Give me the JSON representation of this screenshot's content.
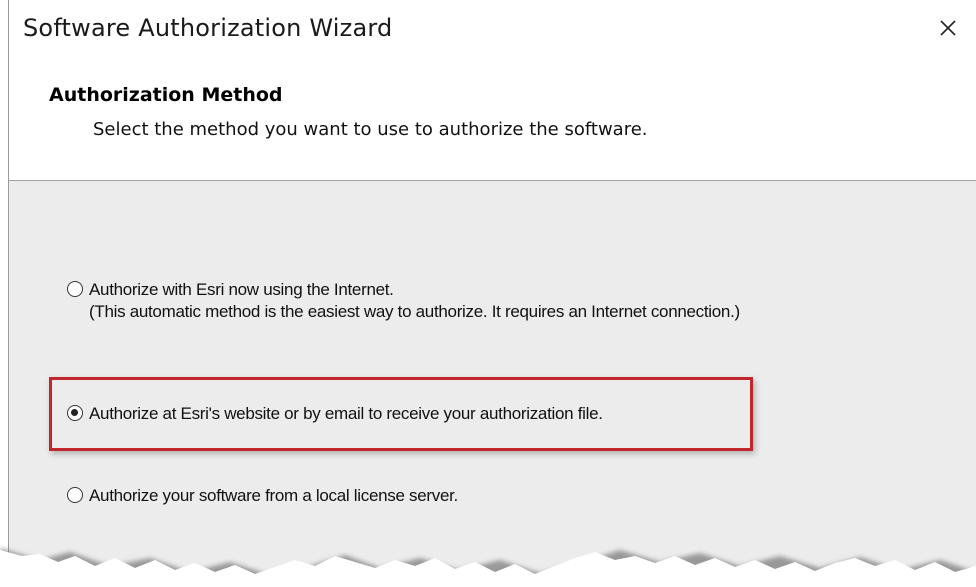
{
  "window": {
    "title": "Software Authorization Wizard"
  },
  "header": {
    "title": "Authorization Method",
    "subtitle": "Select the method you want to use to authorize the software."
  },
  "options": [
    {
      "label": "Authorize with Esri now using the Internet.",
      "detail": "(This automatic method is the easiest way to authorize. It requires an Internet connection.)",
      "selected": false
    },
    {
      "label": "Authorize at Esri's website or by email to receive your authorization file.",
      "selected": true
    },
    {
      "label": "Authorize your software from a local license server.",
      "selected": false
    }
  ],
  "colors": {
    "highlight": "#c0262a",
    "body_bg": "#ececec"
  },
  "icons": {
    "close": "close-icon"
  }
}
